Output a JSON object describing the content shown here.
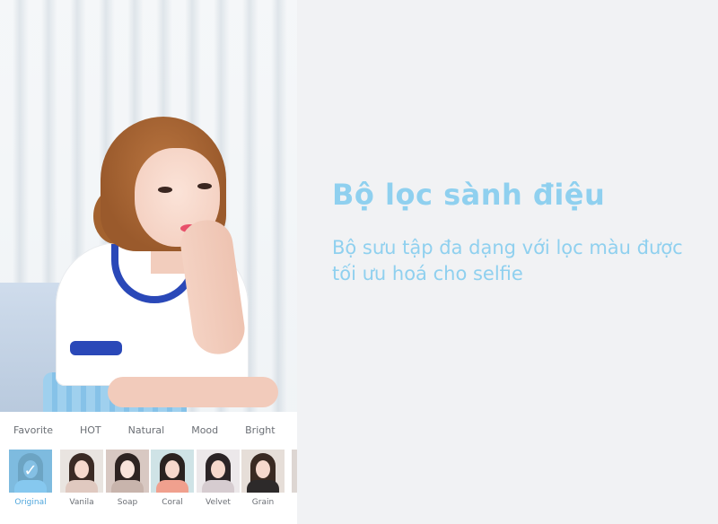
{
  "promo": {
    "title": "Bộ lọc sành điệu",
    "subtitle": "Bộ sưu tập đa dạng với lọc màu được tối ưu hoá cho selfie"
  },
  "filter_tabs": [
    "Favorite",
    "HOT",
    "Natural",
    "Mood",
    "Bright"
  ],
  "filters": [
    {
      "name": "Original",
      "selected": true
    },
    {
      "name": "Vanila",
      "selected": false
    },
    {
      "name": "Soap",
      "selected": false
    },
    {
      "name": "Coral",
      "selected": false
    },
    {
      "name": "Velvet",
      "selected": false
    },
    {
      "name": "Grain",
      "selected": false
    }
  ],
  "icons": {
    "selected_check": "checkmark-icon"
  },
  "colors": {
    "accent": "#8fd0ef",
    "selected_label": "#4fa6dc",
    "sleeve_trim": "#2a48b8",
    "background": "#f1f2f4"
  }
}
